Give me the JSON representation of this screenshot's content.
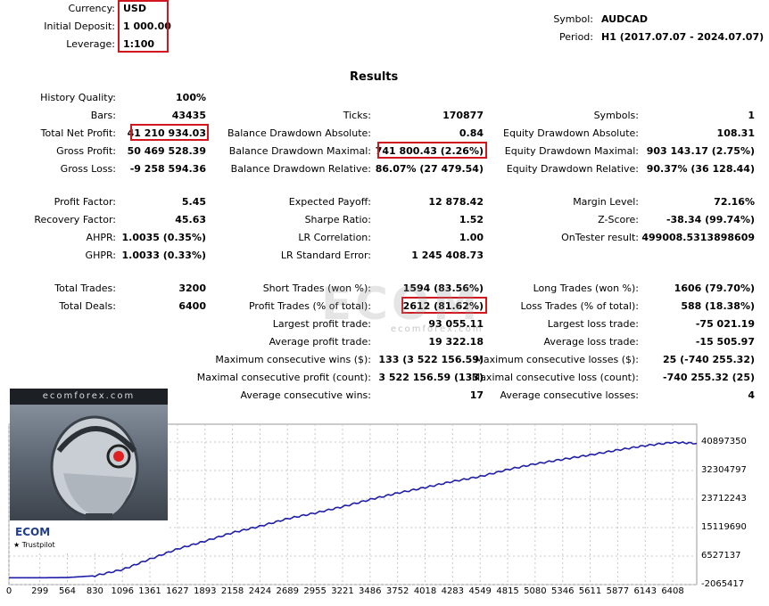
{
  "header": {
    "currency_label": "Currency:",
    "currency_value": "USD",
    "deposit_label": "Initial Deposit:",
    "deposit_value": "1 000.00",
    "leverage_label": "Leverage:",
    "leverage_value": "1:100",
    "symbol_label": "Symbol:",
    "symbol_value": "AUDCAD",
    "period_label": "Period:",
    "period_value": "H1 (2017.07.07 - 2024.07.07)"
  },
  "results_title": "Results",
  "col1": [
    {
      "label": "History Quality:",
      "value": "100%"
    },
    {
      "label": "Bars:",
      "value": "43435"
    },
    {
      "label": "Total Net Profit:",
      "value": "41 210 934.03"
    },
    {
      "label": "Gross Profit:",
      "value": "50 469 528.39"
    },
    {
      "label": "Gross Loss:",
      "value": "-9 258 594.36"
    },
    {
      "label": "Profit Factor:",
      "value": "5.45"
    },
    {
      "label": "Recovery Factor:",
      "value": "45.63"
    },
    {
      "label": "AHPR:",
      "value": "1.0035 (0.35%)"
    },
    {
      "label": "GHPR:",
      "value": "1.0033 (0.33%)"
    },
    {
      "label": "Total Trades:",
      "value": "3200"
    },
    {
      "label": "Total Deals:",
      "value": "6400"
    }
  ],
  "col2": [
    {
      "label": "Ticks:",
      "value": "170877"
    },
    {
      "label": "Balance Drawdown Absolute:",
      "value": "0.84"
    },
    {
      "label": "Balance Drawdown Maximal:",
      "value": "741 800.43 (2.26%)"
    },
    {
      "label": "Balance Drawdown Relative:",
      "value": "86.07% (27 479.54)"
    },
    {
      "label": "Expected Payoff:",
      "value": "12 878.42"
    },
    {
      "label": "Sharpe Ratio:",
      "value": "1.52"
    },
    {
      "label": "LR Correlation:",
      "value": "1.00"
    },
    {
      "label": "LR Standard Error:",
      "value": "1 245 408.73"
    },
    {
      "label": "Short Trades (won %):",
      "value": "1594 (83.56%)"
    },
    {
      "label": "Profit Trades (% of total):",
      "value": "2612 (81.62%)"
    },
    {
      "label": "Largest profit trade:",
      "value": "93 055.11"
    },
    {
      "label": "Average profit trade:",
      "value": "19 322.18"
    },
    {
      "label": "Maximum consecutive wins ($):",
      "value": "133 (3 522 156.59)"
    },
    {
      "label": "Maximal consecutive profit (count):",
      "value": "3 522 156.59 (133)"
    },
    {
      "label": "Average consecutive wins:",
      "value": "17"
    }
  ],
  "col3": [
    {
      "label": "Symbols:",
      "value": "1"
    },
    {
      "label": "Equity Drawdown Absolute:",
      "value": "108.31"
    },
    {
      "label": "Equity Drawdown Maximal:",
      "value": "903 143.17 (2.75%)"
    },
    {
      "label": "Equity Drawdown Relative:",
      "value": "90.37% (36 128.44)"
    },
    {
      "label": "Margin Level:",
      "value": "72.16%"
    },
    {
      "label": "Z-Score:",
      "value": "-38.34 (99.74%)"
    },
    {
      "label": "OnTester result:",
      "value": "499008.5313898609"
    },
    {
      "label": "Long Trades (won %):",
      "value": "1606 (79.70%)"
    },
    {
      "label": "Loss Trades (% of total):",
      "value": "588 (18.38%)"
    },
    {
      "label": "Largest loss trade:",
      "value": "-75 021.19"
    },
    {
      "label": "Average loss trade:",
      "value": "-15 505.97"
    },
    {
      "label": "Maximum consecutive losses ($):",
      "value": "25 (-740 255.32)"
    },
    {
      "label": "Maximal consecutive loss (count):",
      "value": "-740 255.32 (25)"
    },
    {
      "label": "Average consecutive losses:",
      "value": "4"
    }
  ],
  "watermark": {
    "text": "ECOM",
    "sub": "ecomforex.com"
  },
  "thumbnail": {
    "header_text": "ecomforex.com",
    "logo_text": "ECOM",
    "trustpilot_text": "★ Trustpilot"
  },
  "colors": {
    "highlight": "#d2161e",
    "line": "#1f1fa8",
    "grid": "#c8c8c8"
  },
  "chart_data": {
    "type": "line",
    "title": "",
    "x_ticks": [
      "0",
      "299",
      "564",
      "830",
      "1096",
      "1361",
      "1627",
      "1893",
      "2158",
      "2424",
      "2689",
      "2955",
      "3221",
      "3486",
      "3752",
      "4018",
      "4283",
      "4549",
      "4815",
      "5080",
      "5346",
      "5611",
      "5877",
      "6143",
      "6408"
    ],
    "y_ticks": [
      "40897350",
      "32304797",
      "23712243",
      "15119690",
      "6527137",
      "-2065417"
    ],
    "ylim": [
      -2065417,
      43000000
    ],
    "xlim": [
      0,
      6640
    ],
    "series": [
      {
        "x": [
          0,
          300,
          560,
          830,
          1100,
          1360,
          1630,
          1890,
          2160,
          2420,
          2690,
          2955,
          3220,
          3490,
          3750,
          4020,
          4280,
          4550,
          4815,
          5080,
          5350,
          5610,
          5880,
          6140,
          6410,
          6640
        ],
        "y": [
          0,
          0,
          60000,
          600000,
          2500000,
          5600000,
          8700000,
          11000000,
          13600000,
          15500000,
          17800000,
          19500000,
          21400000,
          23600000,
          25500000,
          27200000,
          29000000,
          30500000,
          32600000,
          34300000,
          35700000,
          37000000,
          38500000,
          39800000,
          40800000,
          40500000
        ]
      }
    ]
  }
}
